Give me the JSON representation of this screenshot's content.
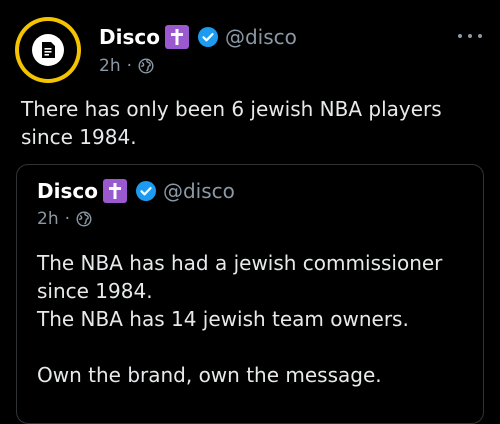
{
  "post": {
    "author_name": "Disco",
    "author_handle": "@disco",
    "time": "2h",
    "separator": "·",
    "text": "There has only been 6 jewish NBA players since 1984.",
    "icons": {
      "avatar": "disco-logo-avatar",
      "badge": "latin-cross-badge",
      "verified": "verified-checkmark",
      "audience": "globe-icon",
      "menu": "more-options-icon"
    }
  },
  "quote": {
    "author_name": "Disco",
    "author_handle": "@disco",
    "time": "2h",
    "separator": "·",
    "lines": [
      "The NBA has had a jewish commissioner since 1984.",
      "The NBA has 14 jewish team owners.",
      "",
      "Own the brand, own the message."
    ]
  },
  "colors": {
    "background": "#000000",
    "text": "#e7e9ea",
    "muted": "#8b98a5",
    "avatar_ring": "#f5c400",
    "badge": "#9b59d0",
    "verified": "#1d9bf0",
    "border": "#2f3336"
  }
}
